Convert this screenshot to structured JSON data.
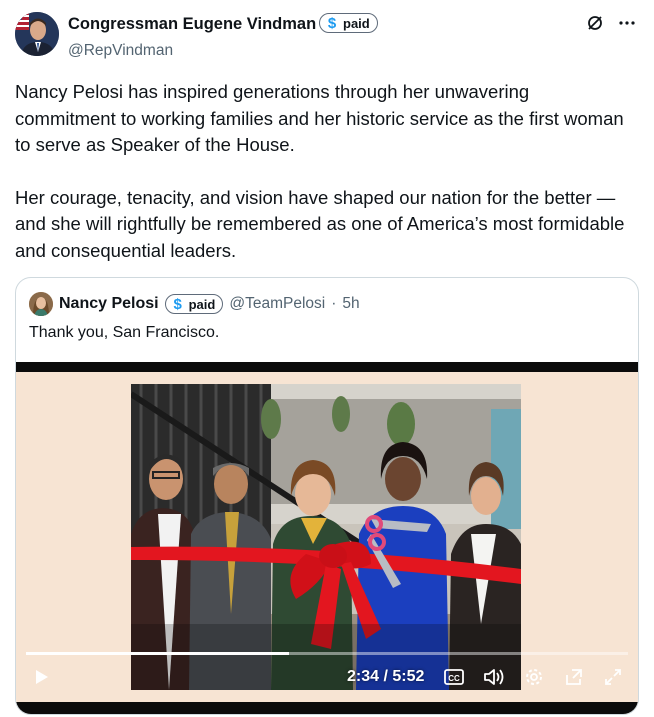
{
  "author": {
    "name": "Congressman Eugene Vindman",
    "badge_label": "paid",
    "handle": "@RepVindman"
  },
  "post": {
    "paragraph_1": "Nancy Pelosi has inspired generations through her unwavering commitment to working families and her historic service as the first woman to serve as Speaker of the House.",
    "paragraph_2": "Her courage, tenacity, and vision have shaped our nation for the better — and she will rightfully be remembered as one of America’s most formidable and consequential leaders."
  },
  "quoted": {
    "name": "Nancy Pelosi",
    "badge_label": "paid",
    "handle": "@TeamPelosi",
    "separator": "·",
    "time_ago": "5h",
    "text": "Thank you, San Francisco."
  },
  "video": {
    "time_display": "2:34 / 5:52",
    "progress": 0.437
  },
  "icons": {
    "badge": "dollar-icon",
    "top": [
      "grok-icon",
      "more-icon"
    ],
    "controls": [
      "play-icon",
      "captions-icon",
      "volume-icon",
      "settings-icon",
      "pop-out-icon",
      "fullscreen-icon"
    ]
  },
  "colors": {
    "accent": "#1d9bf0",
    "secondary_text": "#536471",
    "ribbon": "#e3161f"
  }
}
